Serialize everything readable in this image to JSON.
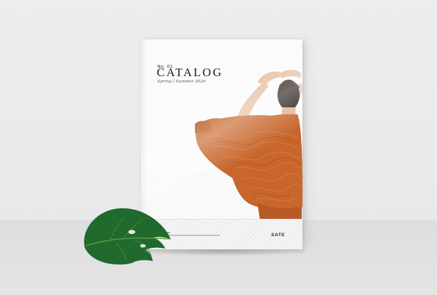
{
  "catalog": {
    "issue": "No. 01",
    "title": "CATALOG",
    "subtitle": "Spring / Summer 2020",
    "brand": "SATE"
  },
  "colors": {
    "background": "#ebebeb",
    "cover": "#fbfbfb",
    "sweater": "#c8662b",
    "leaf": "#1f6a2c"
  }
}
